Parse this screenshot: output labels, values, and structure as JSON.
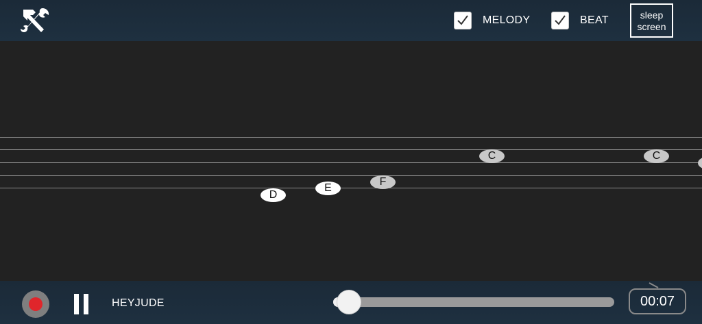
{
  "topbar": {
    "tools_icon": "tools-icon",
    "melody": {
      "label": "MELODY",
      "checked": true
    },
    "beat": {
      "label": "BEAT",
      "checked": true
    },
    "sleep_button": {
      "line1": "sleep",
      "line2": "screen"
    }
  },
  "staff": {
    "notes": [
      {
        "label": "D",
        "style": "white"
      },
      {
        "label": "E",
        "style": "white"
      },
      {
        "label": "F",
        "style": "gray"
      },
      {
        "label": "C",
        "style": "gray"
      },
      {
        "label": "C",
        "style": "gray"
      }
    ]
  },
  "bottombar": {
    "record_icon": "record-icon",
    "pause_icon": "pause-icon",
    "song_title": "HEYJUDE",
    "progress": 0.05,
    "time": "00:07"
  },
  "colors": {
    "bar_bg": "#1e3040",
    "stage_bg": "#222222",
    "record_red": "#e0262b"
  }
}
